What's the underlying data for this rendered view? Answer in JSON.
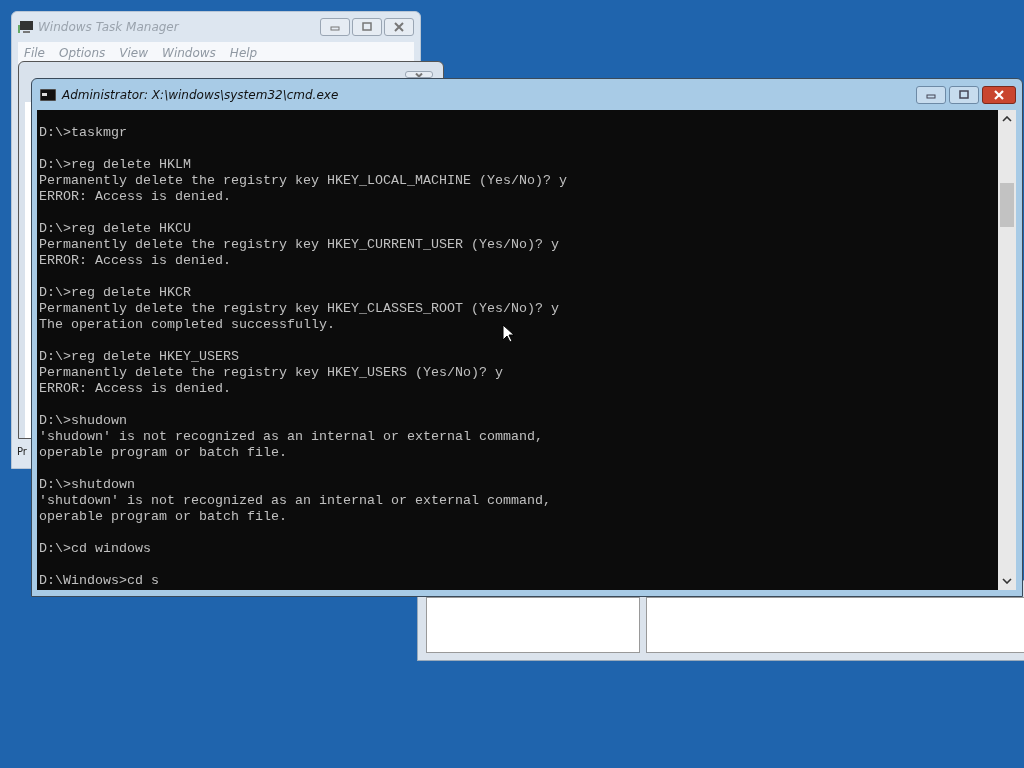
{
  "task_manager": {
    "title": "Windows Task Manager",
    "menu": [
      "File",
      "Options",
      "View",
      "Windows",
      "Help"
    ],
    "status_text": "Pr"
  },
  "console": {
    "title": "Administrator: X:\\windows\\system32\\cmd.exe",
    "blocks": [
      [
        "D:\\>taskmgr"
      ],
      [
        "D:\\>reg delete HKLM",
        "Permanently delete the registry key HKEY_LOCAL_MACHINE (Yes/No)? y",
        "ERROR: Access is denied."
      ],
      [
        "D:\\>reg delete HKCU",
        "Permanently delete the registry key HKEY_CURRENT_USER (Yes/No)? y",
        "ERROR: Access is denied."
      ],
      [
        "D:\\>reg delete HKCR",
        "Permanently delete the registry key HKEY_CLASSES_ROOT (Yes/No)? y",
        "The operation completed successfully."
      ],
      [
        "D:\\>reg delete HKEY_USERS",
        "Permanently delete the registry key HKEY_USERS (Yes/No)? y",
        "ERROR: Access is denied."
      ],
      [
        "D:\\>shudown",
        "'shudown' is not recognized as an internal or external command,",
        "operable program or batch file."
      ],
      [
        "D:\\>shutdown",
        "'shutdown' is not recognized as an internal or external command,",
        "operable program or batch file."
      ],
      [
        "D:\\>cd windows"
      ],
      [
        "D:\\Windows>cd s"
      ]
    ]
  }
}
